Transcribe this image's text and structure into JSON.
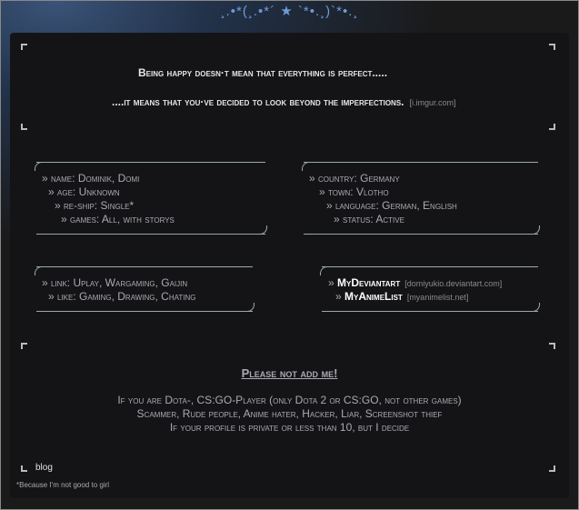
{
  "decoration": "¸.•*(¸.•*´ ★ `*•.¸)`*•.¸",
  "quote": {
    "line1": "Being happy doesn·t mean that everything is perfect.....",
    "line2": "....it means that you·ve decided to look beyond the imperfections.",
    "source": "[i.imgur.com]"
  },
  "info_left": [
    {
      "label": "» name:",
      "value": "Dominik, Domi"
    },
    {
      "label": "» age:",
      "value": "Unknown"
    },
    {
      "label": "» re-ship:",
      "value": "Single*"
    },
    {
      "label": "» games:",
      "value": "All, with storys"
    }
  ],
  "info_right": [
    {
      "label": "» country:",
      "value": "Germany"
    },
    {
      "label": "» town:",
      "value": "Vlotho"
    },
    {
      "label": "» language:",
      "value": "German, English"
    },
    {
      "label": "» status:",
      "value": "Active"
    }
  ],
  "misc": [
    {
      "label": "» link:",
      "value": "Uplay, Wargaming, Gaijin"
    },
    {
      "label": "» like:",
      "value": "Gaming, Drawing, Chating"
    }
  ],
  "links": [
    {
      "prefix": "»",
      "label": "MyDeviantart",
      "source": "[domiyukio.deviantart.com]"
    },
    {
      "prefix": "»",
      "label": "MyAnimeList",
      "source": "[myanimelist.net]"
    }
  ],
  "warning": {
    "title": "Please not add me!",
    "lines": [
      "If you are Dota-, CS:GO-Player (only Dota 2 or CS:GO, not other games)",
      "Scammer, Rude people, Anime hater, Hacker, Liar, Screenshot thief",
      "If your profile is private or less than 10, but I decide"
    ]
  },
  "blog_label": "blog",
  "footnote": "*Because I'm not good to girl"
}
